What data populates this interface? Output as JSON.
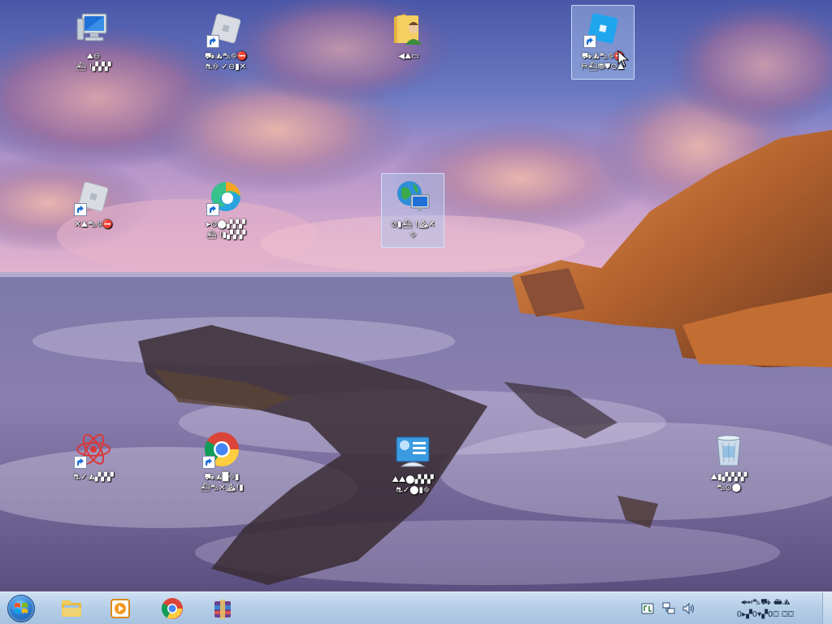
{
  "desktop": {
    "icons": [
      {
        "id": "computer",
        "label": "⛰⊖\n⛴ !▞▞▞",
        "icon": "computer-icon",
        "shortcut": false,
        "selected": false
      },
      {
        "id": "roblox-studio",
        "label": "⛟⛰⛍⛗⛔\n⛐⛗ ✓⊖▮✕",
        "icon": "roblox-icon",
        "shortcut": true,
        "selected": false
      },
      {
        "id": "user-folder",
        "label": "◀⛰▭",
        "icon": "user-folder-icon",
        "shortcut": false,
        "selected": false
      },
      {
        "id": "roblox-player",
        "label": "⛟⛰⛍⛗⛔\n⛿⛴⛃⛊⊙⛰",
        "icon": "roblox-blue-icon",
        "shortcut": true,
        "selected": true
      },
      {
        "id": "roblox-2",
        "label": "✕⛰⛍⛗⛔",
        "icon": "roblox-icon",
        "shortcut": true,
        "selected": false
      },
      {
        "id": "edge",
        "label": "▸⊙⬤▞▞▞\n⛴ !▮▞▞▞",
        "icon": "edge-icon",
        "shortcut": true,
        "selected": false
      },
      {
        "id": "network",
        "label": "⊘▮⛴ !⛰✕\n⛗",
        "icon": "network-globe-icon",
        "shortcut": false,
        "selected": true
      },
      {
        "id": "atom-app",
        "label": "⛐✓⛰▞▞▞",
        "icon": "atom-icon",
        "shortcut": true,
        "selected": false
      },
      {
        "id": "chrome",
        "label": "⛟⛰█⛗▮\n⛴⛍✕⛰!▮",
        "icon": "chrome-icon",
        "shortcut": true,
        "selected": false
      },
      {
        "id": "control-panel",
        "label": "⛰⛰⬤▞▞▞\n⛐✓⬤▮⛗",
        "icon": "control-panel-icon",
        "shortcut": false,
        "selected": false
      },
      {
        "id": "recycle-bin",
        "label": "⛰▮▞▞▞▞\n⛍⊙⬤",
        "icon": "recycle-bin-icon",
        "shortcut": false,
        "selected": false
      }
    ]
  },
  "taskbar": {
    "start_label": "Start",
    "pinned": [
      {
        "id": "explorer",
        "icon": "file-explorer-icon"
      },
      {
        "id": "media-player",
        "icon": "media-player-icon"
      },
      {
        "id": "chrome",
        "icon": "chrome-icon"
      },
      {
        "id": "winrar",
        "icon": "archive-icon"
      }
    ],
    "tray": {
      "items": [
        "touchpad-icon",
        "network-icon",
        "volume-icon"
      ],
      "clock_time": "◂⏭⛍⛟ ⛴⛰",
      "clock_date": "0▸▞0▾▞0⛋ ⛋⛋"
    }
  },
  "colors": {
    "selection": "#aac8f0",
    "taskbar": "#b6cfe8",
    "label_text": "#ffffff"
  }
}
